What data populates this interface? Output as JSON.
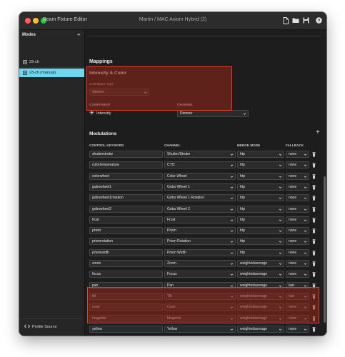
{
  "window": {
    "app_title": "Beam Fixture Editor",
    "doc_title": "Martin  / MAC Axiom Hybrid (2)"
  },
  "toolbar": {
    "icons": [
      "new-file-icon",
      "open-folder-icon",
      "save-icon",
      "help-icon"
    ]
  },
  "sidebar": {
    "header": "Modes",
    "add_label": "+",
    "items": [
      {
        "label": "23-ch",
        "selected": false
      },
      {
        "label": "23-ch (manual)",
        "selected": true
      }
    ],
    "footer_label": "Profile Source"
  },
  "main": {
    "mappings_title": "Mappings",
    "intensity": {
      "title": "Intensity & Color",
      "colorspace_label": "Colorspace Type",
      "colorspace_value": "dimmer",
      "component_header": "COMPONENT",
      "channel_header": "CHANNEL",
      "component_value": "Intensity",
      "channel_value": "Dimmer"
    },
    "modulations": {
      "title": "Modulations",
      "add_label": "+",
      "headers": {
        "control_keyword": "CONTROL KEYWORD",
        "channel": "CHANNEL",
        "merge_mode": "MERGE MODE",
        "fallback": "FALLBACK"
      },
      "rows": [
        {
          "keyword": "shutterstrobe",
          "channel": "Shutter/Strobe",
          "merge": "htp",
          "fallback": "none"
        },
        {
          "keyword": "colortemperature",
          "channel": "CTO",
          "merge": "htp",
          "fallback": "none"
        },
        {
          "keyword": "colorwheel",
          "channel": "Color Wheel",
          "merge": "htp",
          "fallback": "none"
        },
        {
          "keyword": "gobowheel1",
          "channel": "Gobo Wheel 1",
          "merge": "htp",
          "fallback": "none"
        },
        {
          "keyword": "gobowheel1rotation",
          "channel": "Gobo Wheel 1 Rotation",
          "merge": "htp",
          "fallback": "none"
        },
        {
          "keyword": "gobowheel2",
          "channel": "Gobo Wheel 2",
          "merge": "htp",
          "fallback": "none"
        },
        {
          "keyword": "frost",
          "channel": "Frost",
          "merge": "htp",
          "fallback": "none"
        },
        {
          "keyword": "prism",
          "channel": "Prism",
          "merge": "htp",
          "fallback": "none"
        },
        {
          "keyword": "prismrotation",
          "channel": "Prism Rotation",
          "merge": "htp",
          "fallback": "none"
        },
        {
          "keyword": "prismwidth",
          "channel": "Prism Width",
          "merge": "htp",
          "fallback": "none"
        },
        {
          "keyword": "zoom",
          "channel": "Zoom",
          "merge": "weightedaverage",
          "fallback": "none"
        },
        {
          "keyword": "focus",
          "channel": "Focus",
          "merge": "weightedaverage",
          "fallback": "none"
        },
        {
          "keyword": "pan",
          "channel": "Pan",
          "merge": "weightedaverage",
          "fallback": "last"
        },
        {
          "keyword": "tilt",
          "channel": "Tilt",
          "merge": "weightedaverage",
          "fallback": "last"
        },
        {
          "keyword": "cyan",
          "channel": "Cyan",
          "merge": "weightedaverage",
          "fallback": "none"
        },
        {
          "keyword": "magenta",
          "channel": "Magenta",
          "merge": "weightedaverage",
          "fallback": "none"
        },
        {
          "keyword": "yellow",
          "channel": "Yellow",
          "merge": "weightedaverage",
          "fallback": "none"
        }
      ]
    }
  },
  "colors": {
    "accent": "#6fd6f0",
    "highlight_border": "#e0412c",
    "highlight_fill": "#96261880"
  }
}
